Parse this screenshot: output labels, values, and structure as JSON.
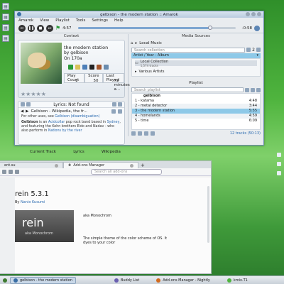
{
  "amarok": {
    "title": "gelbison - the modern station  :: Amarok",
    "menu": [
      "Amarok",
      "View",
      "Playlist",
      "Tools",
      "Settings",
      "Help"
    ],
    "time_elapsed": "4:57",
    "time_remaining": "-0:58",
    "progress_fraction": 0.84,
    "context": {
      "header": "Context",
      "track_title": "the modern station",
      "by_label": "by",
      "artist": "gelbison",
      "on_label": "On",
      "album": "170a",
      "tabs": [
        "Play Count",
        "Score",
        "Last Played"
      ],
      "values": [
        "1",
        "50",
        "72 minutes a..."
      ]
    },
    "lyrics": {
      "title": "Lyrics: Not found",
      "wiki_title": "Gelbison - Wikipedia, the fr...",
      "line1_pre": "For other uses, see",
      "line1_link": "Gelbison (disambiguation)",
      "body_lead": "Gelbison",
      "body_mid": " is an ",
      "body_link1": "Acidcollar",
      "body_after1": " pop rock band based in ",
      "body_link2": "Sydney",
      "body_after2": ", and featuring the Kohn brothers Eido and Nadav - who also perform in ",
      "body_link3": "Nations by the river",
      "tabs": [
        "Current Track",
        "Lyrics",
        "Wikipedia"
      ]
    },
    "sources": {
      "header": "Media Sources",
      "crumb": "Local Music",
      "search_placeholder": "Search collection",
      "spin_value": "2",
      "filter": "Artist / Year - Album",
      "collection_title": "Local Collection",
      "collection_sub": "1,574 tracks",
      "various": "Various Artists"
    },
    "playlist": {
      "header": "Playlist",
      "search_placeholder": "Search playlist",
      "group": "gelbison",
      "rows": [
        {
          "title": "1 - katama",
          "len": "4:48"
        },
        {
          "title": "2 - metal detector",
          "len": "3:44"
        },
        {
          "title": "3 - the modern station",
          "len": "5:55"
        },
        {
          "title": "4 - homelands",
          "len": "4:59"
        },
        {
          "title": "5 - time",
          "len": "6:09"
        }
      ],
      "current_index": 2,
      "count": "12 tracks (50:13)"
    }
  },
  "firefox": {
    "tab1": "ent.su",
    "tab2": "Add-ons Manager",
    "search_placeholder": "Search all add-ons",
    "addon_title": "rein  5.3.1",
    "author_label": "By",
    "author": "Nanio Kusumi",
    "preview_logo": "rein",
    "preview_sub": "aka Monochrom",
    "addon_name": "aka Monochrom",
    "addon_desc": "The simple theme of the color scheme of OS. It dyes to your color"
  },
  "taskbar": {
    "items": [
      "gelbison - the modern station",
      "Buddy List",
      "Add-ons Manager - Nightly",
      "kmix.T1"
    ]
  }
}
